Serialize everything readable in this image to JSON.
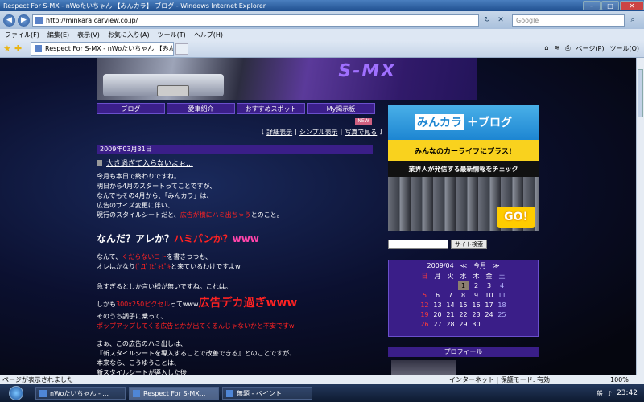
{
  "window": {
    "title": "Respect For S-MX - nWoたいちゃん 【みんカラ】 ブログ - Windows Internet Explorer"
  },
  "address": {
    "url": "http://minkara.carview.co.jp/",
    "search_placeholder": "Google"
  },
  "menu": [
    "ファイル(F)",
    "編集(E)",
    "表示(V)",
    "お気に入り(A)",
    "ツール(T)",
    "ヘルプ(H)"
  ],
  "tab": {
    "label": "Respect For S-MX - nWoたいちゃん 【みんカ..."
  },
  "toolbar": {
    "page_label": "ページ(P)",
    "tools_label": "ツール(O)"
  },
  "nav": [
    "ブログ",
    "愛車紹介",
    "おすすめスポット",
    "My掲示板"
  ],
  "new_badge": "NEW",
  "view_links": {
    "detail": "詳細表示",
    "simple": "シンプル表示",
    "photo": "写真で見る"
  },
  "post": {
    "date": "2009年03月31日",
    "title": "大き過ぎて入らないよぉ…",
    "p1": [
      "今月も本日で終わりですね。",
      "明日から4月のスタートってことですが、",
      "なんでもその4月から、「みんカラ」は、",
      "広告のサイズ変更に伴い、"
    ],
    "p1_last_a": "現行のスタイルシートだと、",
    "p1_last_b": "広告が横にハミ出ちゃう",
    "p1_last_c": "とのこと。",
    "h1_a": "なんだ？アレか？",
    "h1_b": "ハミパンか？",
    "h1_c": "www",
    "p2_a": "なんて、",
    "p2_b": "くだらないコト",
    "p2_c": "を書きつつも、",
    "p2_d": "オレはかなり",
    "p2_e": "(ﾟДﾟ)ﾋﾟｷﾋﾟｷ",
    "p2_f": "と来ているわけですよw",
    "p3": "急すぎるとしか言い様が無いですね。これは。",
    "p4_a": "しかも",
    "p4_b": "300x250ピクセル",
    "p4_c": "ってwww",
    "p4_d": "広告デカ過ぎwww",
    "p5": "そのうち調子に乗って、",
    "p6": "ポップアップしてくる広告とかが出てくるんじゃないかと不安ですw",
    "p7": [
      "まぁ、この広告のハミ出しは、",
      "『新スタイルシートを導入することで改善できる』とのことですが、",
      "本来なら、こうゆうことは、",
      "新スタイルシートが導入した後"
    ]
  },
  "banner": {
    "brand_a": "みんカラ",
    "brand_b": "＋",
    "brand_c": "ブログ",
    "tagline": "みんなのカーライフにプラス!",
    "sub": "業界人が発信する最新情報をチェック",
    "go": "GO!"
  },
  "search": {
    "button": "サイト検索"
  },
  "calendar": {
    "month": "2009/04",
    "prev": "≪",
    "current_label": "今月",
    "next": "≫",
    "weekdays": [
      "日",
      "月",
      "火",
      "水",
      "木",
      "金",
      "土"
    ],
    "weeks": [
      [
        "",
        "",
        "",
        "1",
        "2",
        "3",
        "4"
      ],
      [
        "5",
        "6",
        "7",
        "8",
        "9",
        "10",
        "11"
      ],
      [
        "12",
        "13",
        "14",
        "15",
        "16",
        "17",
        "18"
      ],
      [
        "19",
        "20",
        "21",
        "22",
        "23",
        "24",
        "25"
      ],
      [
        "26",
        "27",
        "28",
        "29",
        "30",
        "",
        ""
      ]
    ],
    "today": "1"
  },
  "profile": {
    "header": "プロフィール"
  },
  "status": {
    "text": "ページが表示されました",
    "zone": "インターネット | 保護モード: 有効",
    "zoom": "100%"
  },
  "taskbar": {
    "items": [
      "nWoたいちゃん - ...",
      "Respect For S-MX...",
      "無題 - ペイント"
    ],
    "clock": "23:42",
    "ime": "般"
  },
  "colors": {
    "accent": "#3a1e88",
    "emphasis": "#ff2222",
    "pink": "#ff44aa"
  }
}
